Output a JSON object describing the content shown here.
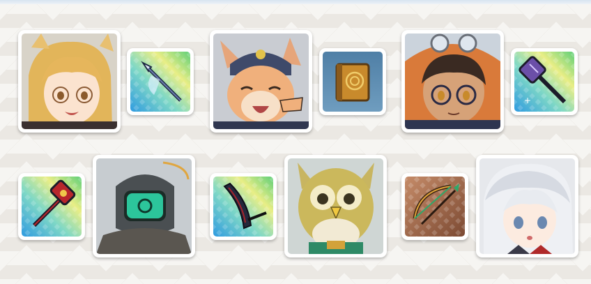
{
  "colors": {
    "card_border": "#ffffff",
    "tile_rainbow": [
      "#3aa8e0",
      "#8fd6c0",
      "#f1ec7a",
      "#6fcf7c"
    ],
    "tile_bronze": [
      "#8a5a3e",
      "#d09a78"
    ]
  },
  "row1": [
    {
      "type": "character",
      "icon": "blonde-glasses-character-portrait"
    },
    {
      "type": "weapon",
      "icon": "spear-icon",
      "tile": "rainbow"
    },
    {
      "type": "character",
      "icon": "cat-knight-character-portrait"
    },
    {
      "type": "weapon",
      "icon": "spellbook-icon",
      "tile": "blue"
    },
    {
      "type": "character",
      "icon": "goggles-glasses-character-portrait"
    },
    {
      "type": "weapon",
      "icon": "mace-icon",
      "tile": "rainbow"
    }
  ],
  "row2": [
    {
      "type": "weapon",
      "icon": "hammer-icon",
      "tile": "rainbow"
    },
    {
      "type": "character",
      "icon": "robot-visor-character-portrait"
    },
    {
      "type": "weapon",
      "icon": "scythe-blade-icon",
      "tile": "rainbow"
    },
    {
      "type": "character",
      "icon": "owl-character-portrait"
    },
    {
      "type": "weapon",
      "icon": "crossbow-icon",
      "tile": "bronze"
    },
    {
      "type": "character",
      "icon": "white-hair-character-portrait"
    }
  ]
}
